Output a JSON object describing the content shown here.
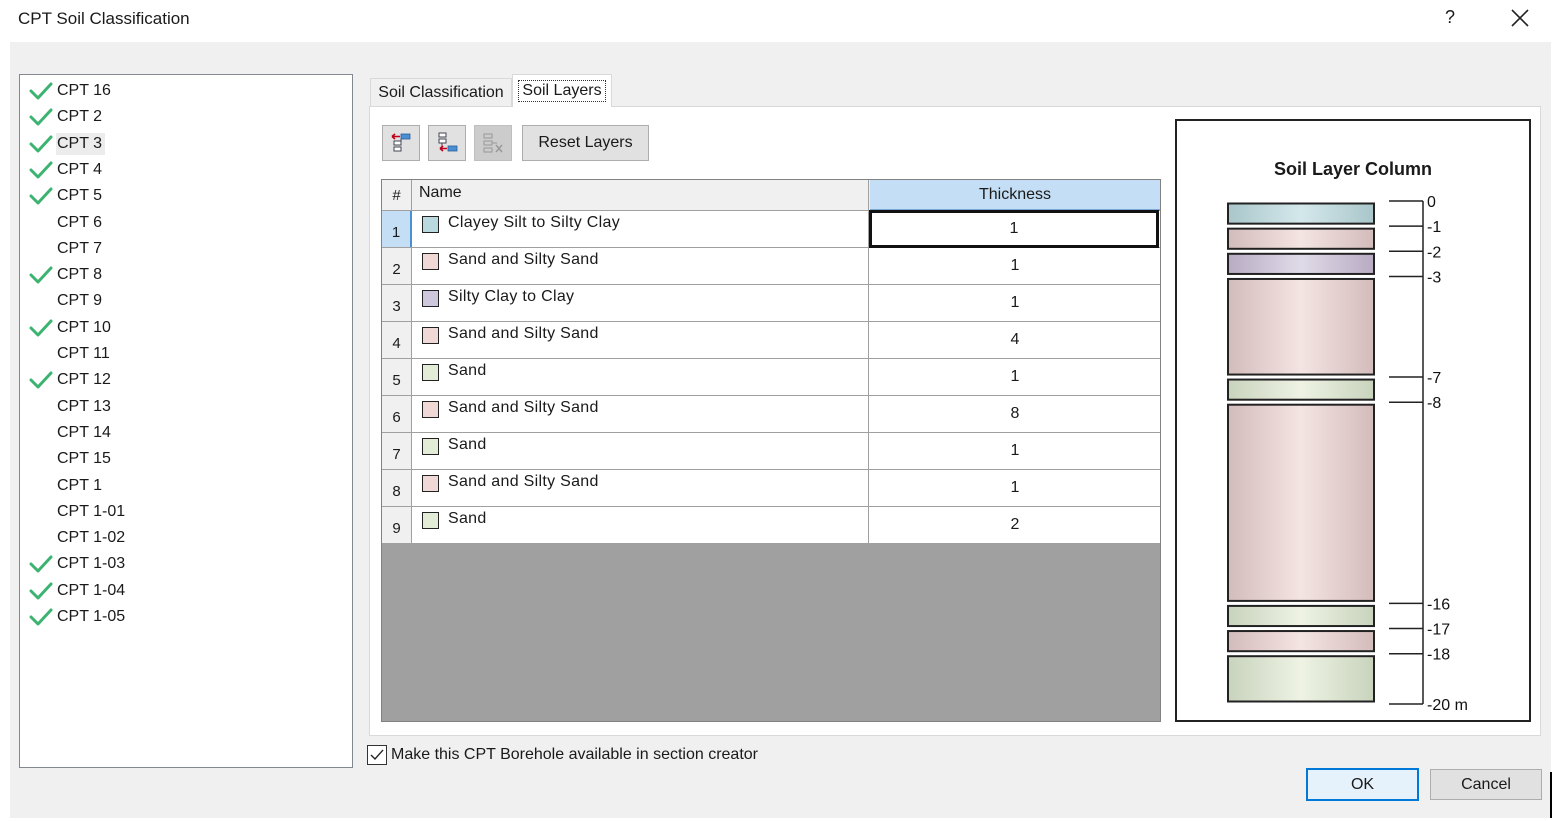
{
  "window": {
    "title": "CPT Soil Classification",
    "help_label": "?",
    "close_icon": "close-icon"
  },
  "cpt_list": [
    {
      "label": "CPT 16",
      "checked": true
    },
    {
      "label": "CPT 2",
      "checked": true
    },
    {
      "label": "CPT 3",
      "checked": true,
      "hover": true
    },
    {
      "label": "CPT 4",
      "checked": true
    },
    {
      "label": "CPT 5",
      "checked": true
    },
    {
      "label": "CPT 6",
      "checked": false
    },
    {
      "label": "CPT 7",
      "checked": false
    },
    {
      "label": "CPT 8",
      "checked": true
    },
    {
      "label": "CPT 9",
      "checked": false
    },
    {
      "label": "CPT 10",
      "checked": true
    },
    {
      "label": "CPT 11",
      "checked": false
    },
    {
      "label": "CPT 12",
      "checked": true
    },
    {
      "label": "CPT 13",
      "checked": false
    },
    {
      "label": "CPT 14",
      "checked": false
    },
    {
      "label": "CPT 15",
      "checked": false
    },
    {
      "label": "CPT 1",
      "checked": false
    },
    {
      "label": "CPT 1-01",
      "checked": false
    },
    {
      "label": "CPT 1-02",
      "checked": false
    },
    {
      "label": "CPT 1-03",
      "checked": true
    },
    {
      "label": "CPT 1-04",
      "checked": true
    },
    {
      "label": "CPT 1-05",
      "checked": true
    }
  ],
  "tabs": [
    {
      "label": "Soil Classification",
      "active": false
    },
    {
      "label": "Soil Layers",
      "active": true
    }
  ],
  "toolbar": {
    "insert_above_icon": "insert-layer-above-icon",
    "insert_below_icon": "insert-layer-below-icon",
    "delete_icon": "delete-layer-icon",
    "reset_label": "Reset Layers"
  },
  "grid": {
    "headers": {
      "num": "#",
      "name": "Name",
      "thickness": "Thickness"
    },
    "rows": [
      {
        "num": "1",
        "name": "Clayey Silt to Silty Clay",
        "thickness": "1",
        "color": "#b9d9de",
        "selected": true
      },
      {
        "num": "2",
        "name": "Sand and Silty Sand",
        "thickness": "1",
        "color": "#f0d8d6"
      },
      {
        "num": "3",
        "name": "Silty Clay to Clay",
        "thickness": "1",
        "color": "#cfc8dc"
      },
      {
        "num": "4",
        "name": "Sand and Silty Sand",
        "thickness": "4",
        "color": "#f0d8d6"
      },
      {
        "num": "5",
        "name": "Sand",
        "thickness": "1",
        "color": "#e2ecd6"
      },
      {
        "num": "6",
        "name": "Sand and Silty Sand",
        "thickness": "8",
        "color": "#f0d8d6"
      },
      {
        "num": "7",
        "name": "Sand",
        "thickness": "1",
        "color": "#e2ecd6"
      },
      {
        "num": "8",
        "name": "Sand and Silty Sand",
        "thickness": "1",
        "color": "#f0d8d6"
      },
      {
        "num": "9",
        "name": "Sand",
        "thickness": "2",
        "color": "#e2ecd6"
      }
    ]
  },
  "chart_data": {
    "type": "bar",
    "title": "Soil Layer Column",
    "unit": "m",
    "ylim": [
      -20,
      0
    ],
    "layers": [
      {
        "name": "Clayey Silt to Silty Clay",
        "top": 0,
        "bottom": -1,
        "colors": [
          "#a9c6ca",
          "#d4e8eb"
        ]
      },
      {
        "name": "Sand and Silty Sand",
        "top": -1,
        "bottom": -2,
        "colors": [
          "#d3bcbb",
          "#f4e4e2"
        ]
      },
      {
        "name": "Silty Clay to Clay",
        "top": -2,
        "bottom": -3,
        "colors": [
          "#b8abc3",
          "#e0dbe8"
        ]
      },
      {
        "name": "Sand and Silty Sand",
        "top": -3,
        "bottom": -7,
        "colors": [
          "#d3bcbb",
          "#f4e4e2"
        ]
      },
      {
        "name": "Sand",
        "top": -7,
        "bottom": -8,
        "colors": [
          "#c8d3bc",
          "#eef3e4"
        ]
      },
      {
        "name": "Sand and Silty Sand",
        "top": -8,
        "bottom": -16,
        "colors": [
          "#d3bcbb",
          "#f4e4e2"
        ]
      },
      {
        "name": "Sand",
        "top": -16,
        "bottom": -17,
        "colors": [
          "#c8d3bc",
          "#eef3e4"
        ]
      },
      {
        "name": "Sand and Silty Sand",
        "top": -17,
        "bottom": -18,
        "colors": [
          "#d3bcbb",
          "#f4e4e2"
        ]
      },
      {
        "name": "Sand",
        "top": -18,
        "bottom": -20,
        "colors": [
          "#c8d3bc",
          "#eef3e4"
        ]
      }
    ],
    "tick_labels": [
      "0",
      "-1",
      "-2",
      "-3",
      "-7",
      "-8",
      "-16",
      "-17",
      "-18",
      "-20 m"
    ],
    "tick_values": [
      0,
      -1,
      -2,
      -3,
      -7,
      -8,
      -16,
      -17,
      -18,
      -20
    ]
  },
  "footer": {
    "available_checked": true,
    "available_label": "Make this CPT Borehole available in section creator",
    "ok_label": "OK",
    "cancel_label": "Cancel"
  }
}
